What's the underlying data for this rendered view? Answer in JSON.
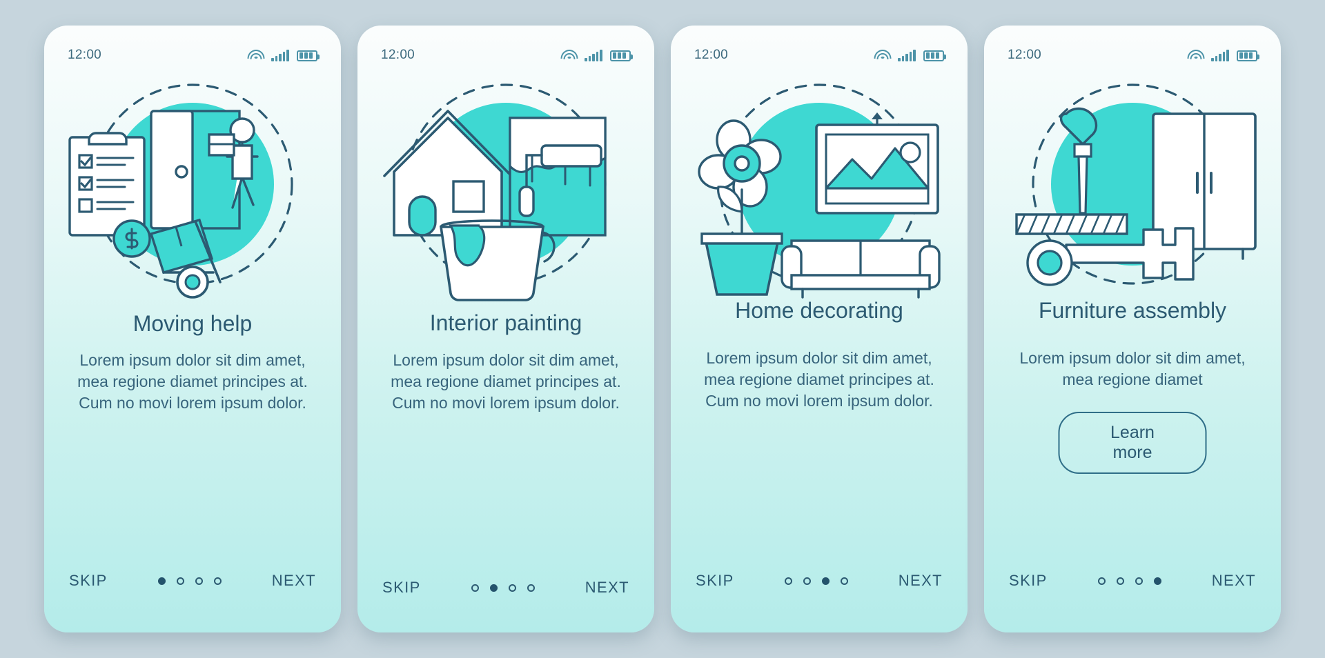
{
  "meta": {
    "background_color": "#c6d5dd",
    "accent_color": "#3ecfc9",
    "stroke_color": "#2c5a72"
  },
  "screens": [
    {
      "id": "moving-help",
      "status_time": "12:00",
      "title": "Moving help",
      "description": "Lorem ipsum dolor sit dim amet, mea regione diamet principes at. Cum no movi lorem ipsum dolor.",
      "skip_label": "SKIP",
      "next_label": "NEXT",
      "dots": 4,
      "active_dot": 1,
      "illustration": "moving-boxes-clipboard-icon",
      "cta": null
    },
    {
      "id": "interior-painting",
      "status_time": "12:00",
      "title": "Interior painting",
      "description": "Lorem ipsum dolor sit dim amet, mea regione diamet principes at. Cum no movi lorem ipsum dolor.",
      "skip_label": "SKIP",
      "next_label": "NEXT",
      "dots": 4,
      "active_dot": 2,
      "illustration": "house-paint-roller-bucket-icon",
      "cta": null
    },
    {
      "id": "home-decorating",
      "status_time": "12:00",
      "title": "Home decorating",
      "description": "Lorem ipsum dolor sit dim amet, mea regione diamet principes at. Cum no movi lorem ipsum dolor.",
      "skip_label": "SKIP",
      "next_label": "NEXT",
      "dots": 4,
      "active_dot": 3,
      "illustration": "sofa-plant-picture-icon",
      "cta": null
    },
    {
      "id": "furniture-assembly",
      "status_time": "12:00",
      "title": "Furniture assembly",
      "description": "Lorem ipsum dolor sit dim amet, mea regione diamet",
      "skip_label": "SKIP",
      "next_label": "NEXT",
      "dots": 4,
      "active_dot": 4,
      "illustration": "wardrobe-wrench-screwdriver-icon",
      "cta": "Learn more"
    }
  ]
}
